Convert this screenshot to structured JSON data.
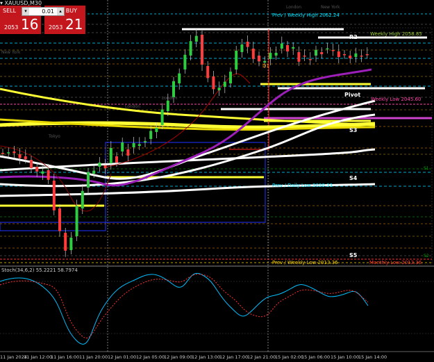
{
  "header": {
    "symbol_title": "▾ XAUUSD,M30"
  },
  "trade_panel": {
    "sell_label": "SELL",
    "buy_label": "BUY",
    "lot_value": "0.01",
    "sell_price_prefix": "2053",
    "sell_price_big": "16",
    "buy_price_prefix": "2053",
    "buy_price_big": "21"
  },
  "level_labels": {
    "prev_weekly_high": "Prev / Weekly High 2062.24",
    "weekly_high": "Weekly High 2058.85",
    "r2": "R2",
    "d1": "D1",
    "pivot": "Pivot",
    "weekly_low": "Weekly Low 2045.60",
    "s3": "S3",
    "s4": "S4",
    "prev_daily_low": "Prev / Daily Low 2030.33",
    "s5": "S5",
    "prev_weekly_low": "Prev / Weekly Low 2013.36",
    "monthly_low": "Monthly Low 2013.36",
    "s1": "S1",
    "s2": "S2"
  },
  "session_labels": {
    "new_york_1": "New York",
    "london_1": "London",
    "new_york_2": "New York",
    "tokyo": "Tokyo",
    "london_2": "London",
    "london_3": "London"
  },
  "indicator": {
    "label": "Stoch(34,6,2) 55.2221 58.7974"
  },
  "time_axis": [
    "11 Jan 2024",
    "11 Jan 12:00",
    "11 Jan 16:00",
    "11 Jan 20:00",
    "12 Jan 01:00",
    "12 Jan 05:00",
    "12 Jan 09:00",
    "12 Jan 13:00",
    "12 Jan 17:00",
    "12 Jan 21:00",
    "15 Jan 02:00",
    "15 Jan 06:00",
    "15 Jan 10:00",
    "15 Jan 14:00"
  ],
  "colors": {
    "background": "#000000",
    "bull_candle": "#2ecc40",
    "bear_candle": "#ff3b3b",
    "sell_buy_panel": "#c4171d",
    "pivot_white": "#ffffff",
    "yellow_ma": "#ffff33",
    "purple_ma": "#9b1fb8",
    "stoch_main": "#00bfff",
    "stoch_signal": "#ff3333"
  }
}
